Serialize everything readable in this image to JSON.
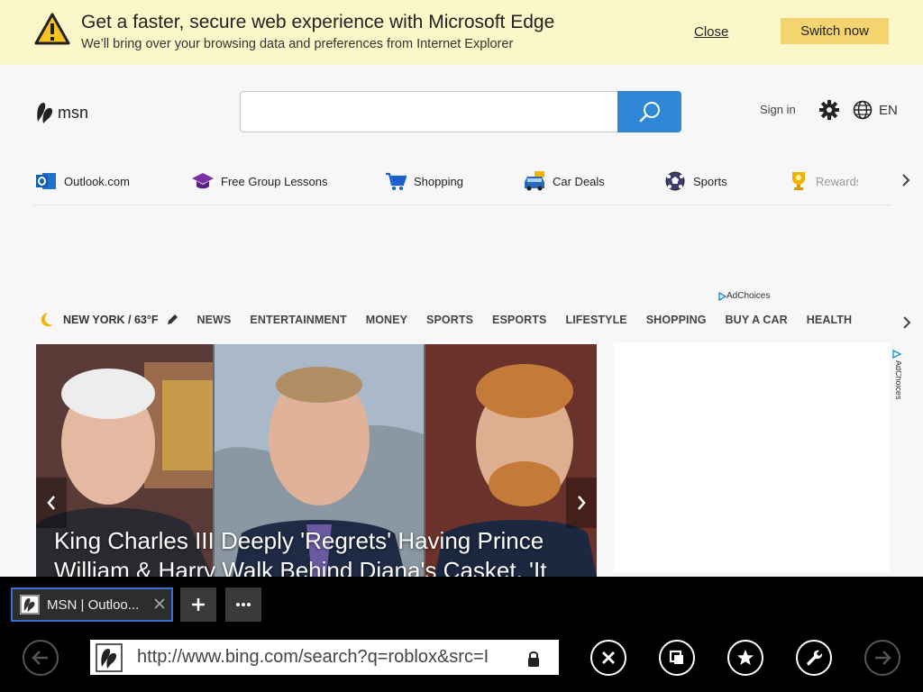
{
  "banner": {
    "title": "Get a faster, secure web experience with Microsoft Edge",
    "subtitle": "We’ll bring over your browsing data and preferences from Internet Explorer",
    "close_label": "Close",
    "switch_label": "Switch now",
    "bg_color": "#fbf7c8",
    "button_color": "#f4d46f"
  },
  "header": {
    "logo_text": "msn",
    "search_placeholder": "",
    "signin_label": "Sign in",
    "lang_label": "EN",
    "search_button_color": "#2f87d8"
  },
  "quicklinks": [
    {
      "label": "Outlook.com",
      "icon": "outlook-icon"
    },
    {
      "label": "Free Group Lessons",
      "icon": "graduation-cap-icon"
    },
    {
      "label": "Shopping",
      "icon": "shopping-cart-icon"
    },
    {
      "label": "Car Deals",
      "icon": "car-icon"
    },
    {
      "label": "Sports",
      "icon": "soccer-ball-icon"
    },
    {
      "label": "Rewards",
      "icon": "trophy-icon"
    }
  ],
  "adchoices_label": "AdChoices",
  "navbar": {
    "weather": "NEW YORK / 63°F",
    "items": [
      "NEWS",
      "ENTERTAINMENT",
      "MONEY",
      "SPORTS",
      "ESPORTS",
      "LIFESTYLE",
      "SHOPPING",
      "BUY A CAR",
      "HEALTH"
    ]
  },
  "hero": {
    "title": "King Charles III Deeply 'Regrets' Having Prince William & Harry Walk Behind Diana's Casket, 'It"
  },
  "browser": {
    "tab_title": "MSN | Outloo...",
    "url": "http://www.bing.com/search?q=roblox&src=I",
    "tab_border_color": "#3a6fd1"
  }
}
